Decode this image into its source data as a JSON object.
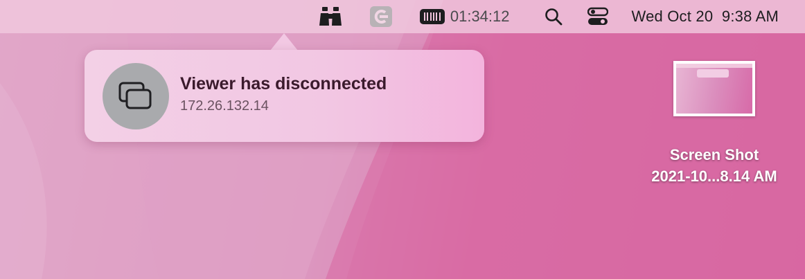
{
  "menubar": {
    "icons": [
      "binoculars-icon",
      "c-app-icon",
      "battery-icon",
      "search-icon",
      "control-center-icon"
    ],
    "battery_time": "01:34:12",
    "datetime": "Wed Oct 20  9:38 AM"
  },
  "notification": {
    "icon": "screens-icon",
    "title": "Viewer has disconnected",
    "subtitle": "172.26.132.14"
  },
  "desktop": {
    "file": {
      "name_line1": "Screen Shot",
      "name_line2": "2021-10...8.14 AM",
      "icon": "screenshot-thumbnail-icon"
    }
  },
  "colors": {
    "wallpaper_left": "#e0a3c7",
    "wallpaper_right": "#d663a0",
    "menubar": "#f0c8de",
    "notification_bg": "#f2c7e3",
    "notification_icon_bg": "#a9aaad"
  }
}
